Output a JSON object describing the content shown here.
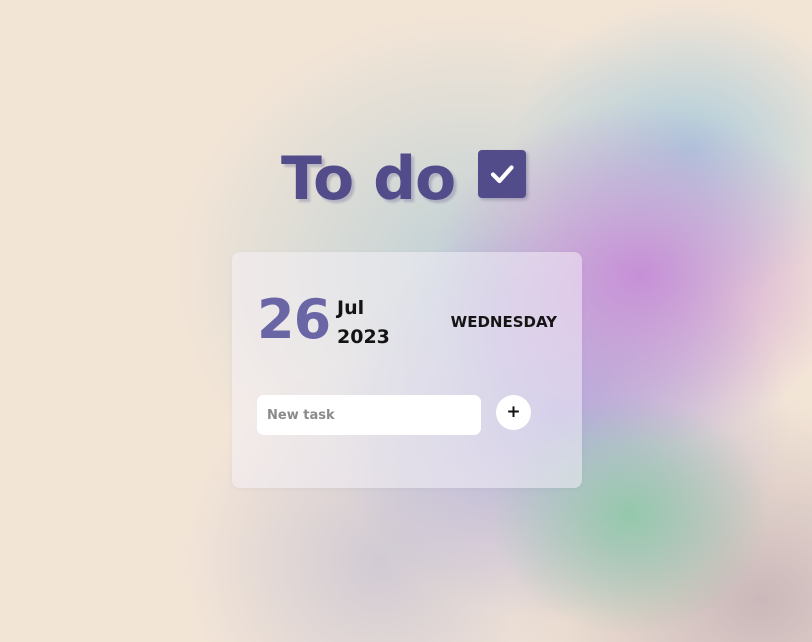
{
  "app": {
    "title": "To do",
    "title_icon": "checkbox-checked-icon"
  },
  "date": {
    "day": "26",
    "month": "Jul",
    "year": "2023",
    "weekday": "WEDNESDAY"
  },
  "task_form": {
    "input_value": "",
    "input_placeholder": "New task",
    "add_button_label": "+"
  },
  "colors": {
    "accent": "#534c8a",
    "date_accent": "#6a66a6",
    "text": "#141414",
    "background": "#f3e5d6"
  }
}
